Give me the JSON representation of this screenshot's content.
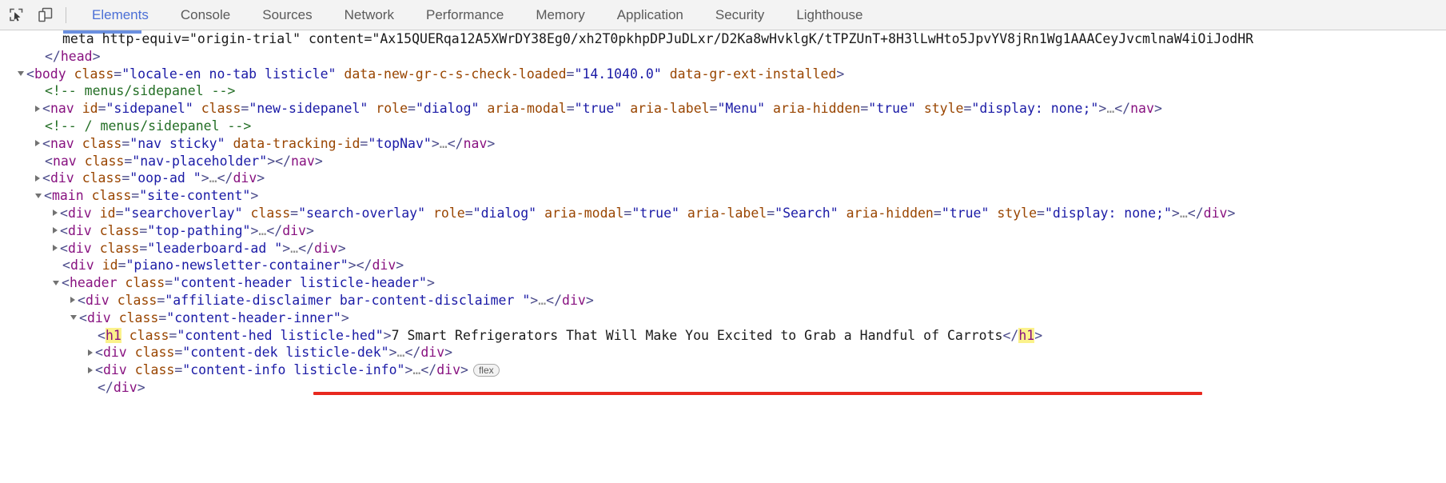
{
  "toolbar": {
    "icons": [
      {
        "name": "inspect-element-icon",
        "title": "Inspect element"
      },
      {
        "name": "device-toolbar-icon",
        "title": "Toggle device toolbar"
      }
    ],
    "tabs": [
      {
        "label": "Elements",
        "active": true
      },
      {
        "label": "Console",
        "active": false
      },
      {
        "label": "Sources",
        "active": false
      },
      {
        "label": "Network",
        "active": false
      },
      {
        "label": "Performance",
        "active": false
      },
      {
        "label": "Memory",
        "active": false
      },
      {
        "label": "Application",
        "active": false
      },
      {
        "label": "Security",
        "active": false
      },
      {
        "label": "Lighthouse",
        "active": false
      }
    ]
  },
  "colors": {
    "accent": "#4b6fd6",
    "tag": "#881280",
    "attr_name": "#994500",
    "attr_value": "#1a1aa6",
    "comment": "#236e25",
    "punctuation": "#4a4a8a",
    "highlight": "#fbf28b",
    "annotation_red": "#e8281e",
    "toolbar_bg": "#f3f3f3"
  },
  "tree": {
    "rows": [
      {
        "id": "meta-origin-trial",
        "text": "<meta http-equiv=\"origin-trial\" content=\"Ax15QUERqa12A5XWrDY38Eg0/xh2T0pkhpDPJuDLxr/D2Ka8wHvklgK/tTPZUnT+8H3lLwHto5JpvYV8jRn1Wg1AAACeyJvcmlnaW4iOiJodHR"
      },
      {
        "id": "head-close",
        "text": "</head>"
      },
      {
        "id": "body-open",
        "text": "<body class=\"locale-en no-tab listicle\" data-new-gr-c-s-check-loaded=\"14.1040.0\" data-gr-ext-installed>"
      },
      {
        "id": "comment-menus-sidepanel",
        "text": "<!-- menus/sidepanel -->"
      },
      {
        "id": "nav-sidepanel",
        "text": "<nav id=\"sidepanel\" class=\"new-sidepanel\" role=\"dialog\" aria-modal=\"true\" aria-label=\"Menu\" aria-hidden=\"true\" style=\"display: none;\">…</nav>"
      },
      {
        "id": "comment-close-menus-sidepanel",
        "text": "<!-- / menus/sidepanel -->"
      },
      {
        "id": "nav-sticky",
        "text": "<nav class=\"nav sticky\" data-tracking-id=\"topNav\">…</nav>"
      },
      {
        "id": "nav-placeholder",
        "text": "<nav class=\"nav-placeholder\"></nav>"
      },
      {
        "id": "div-oop-ad",
        "text": "<div class=\"oop-ad \">…</div>"
      },
      {
        "id": "main-site-content",
        "text": "<main class=\"site-content\">"
      },
      {
        "id": "div-searchoverlay",
        "text": "<div id=\"searchoverlay\" class=\"search-overlay\" role=\"dialog\" aria-modal=\"true\" aria-label=\"Search\" aria-hidden=\"true\" style=\"display: none;\">…</div>"
      },
      {
        "id": "div-top-pathing",
        "text": "<div class=\"top-pathing\">…</div>"
      },
      {
        "id": "div-leaderboard-ad",
        "text": "<div class=\"leaderboard-ad \">…</div>"
      },
      {
        "id": "div-piano-newsletter",
        "text": "<div id=\"piano-newsletter-container\"></div>"
      },
      {
        "id": "header-content-header",
        "text": "<header class=\"content-header listicle-header\">"
      },
      {
        "id": "div-affiliate-disclaimer",
        "text": "<div class=\"affiliate-disclaimer bar-content-disclaimer \">…</div>"
      },
      {
        "id": "div-content-header-inner",
        "text": "<div class=\"content-header-inner\">"
      },
      {
        "id": "h1-listicle-hed",
        "text": "<h1 class=\"content-hed listicle-hed\">7 Smart Refrigerators That Will Make You Excited to Grab a Handful of Carrots</h1>",
        "highlighted_tag": "h1",
        "heading_text": "7 Smart Refrigerators That Will Make You Excited to Grab a Handful of Carrots",
        "annotated": true
      },
      {
        "id": "div-content-dek",
        "text": "<div class=\"content-dek listicle-dek\">…</div>"
      },
      {
        "id": "div-content-info",
        "text": "<div class=\"content-info listicle-info\">…</div>",
        "badge": "flex"
      },
      {
        "id": "div-close",
        "text": "</div>"
      }
    ]
  }
}
